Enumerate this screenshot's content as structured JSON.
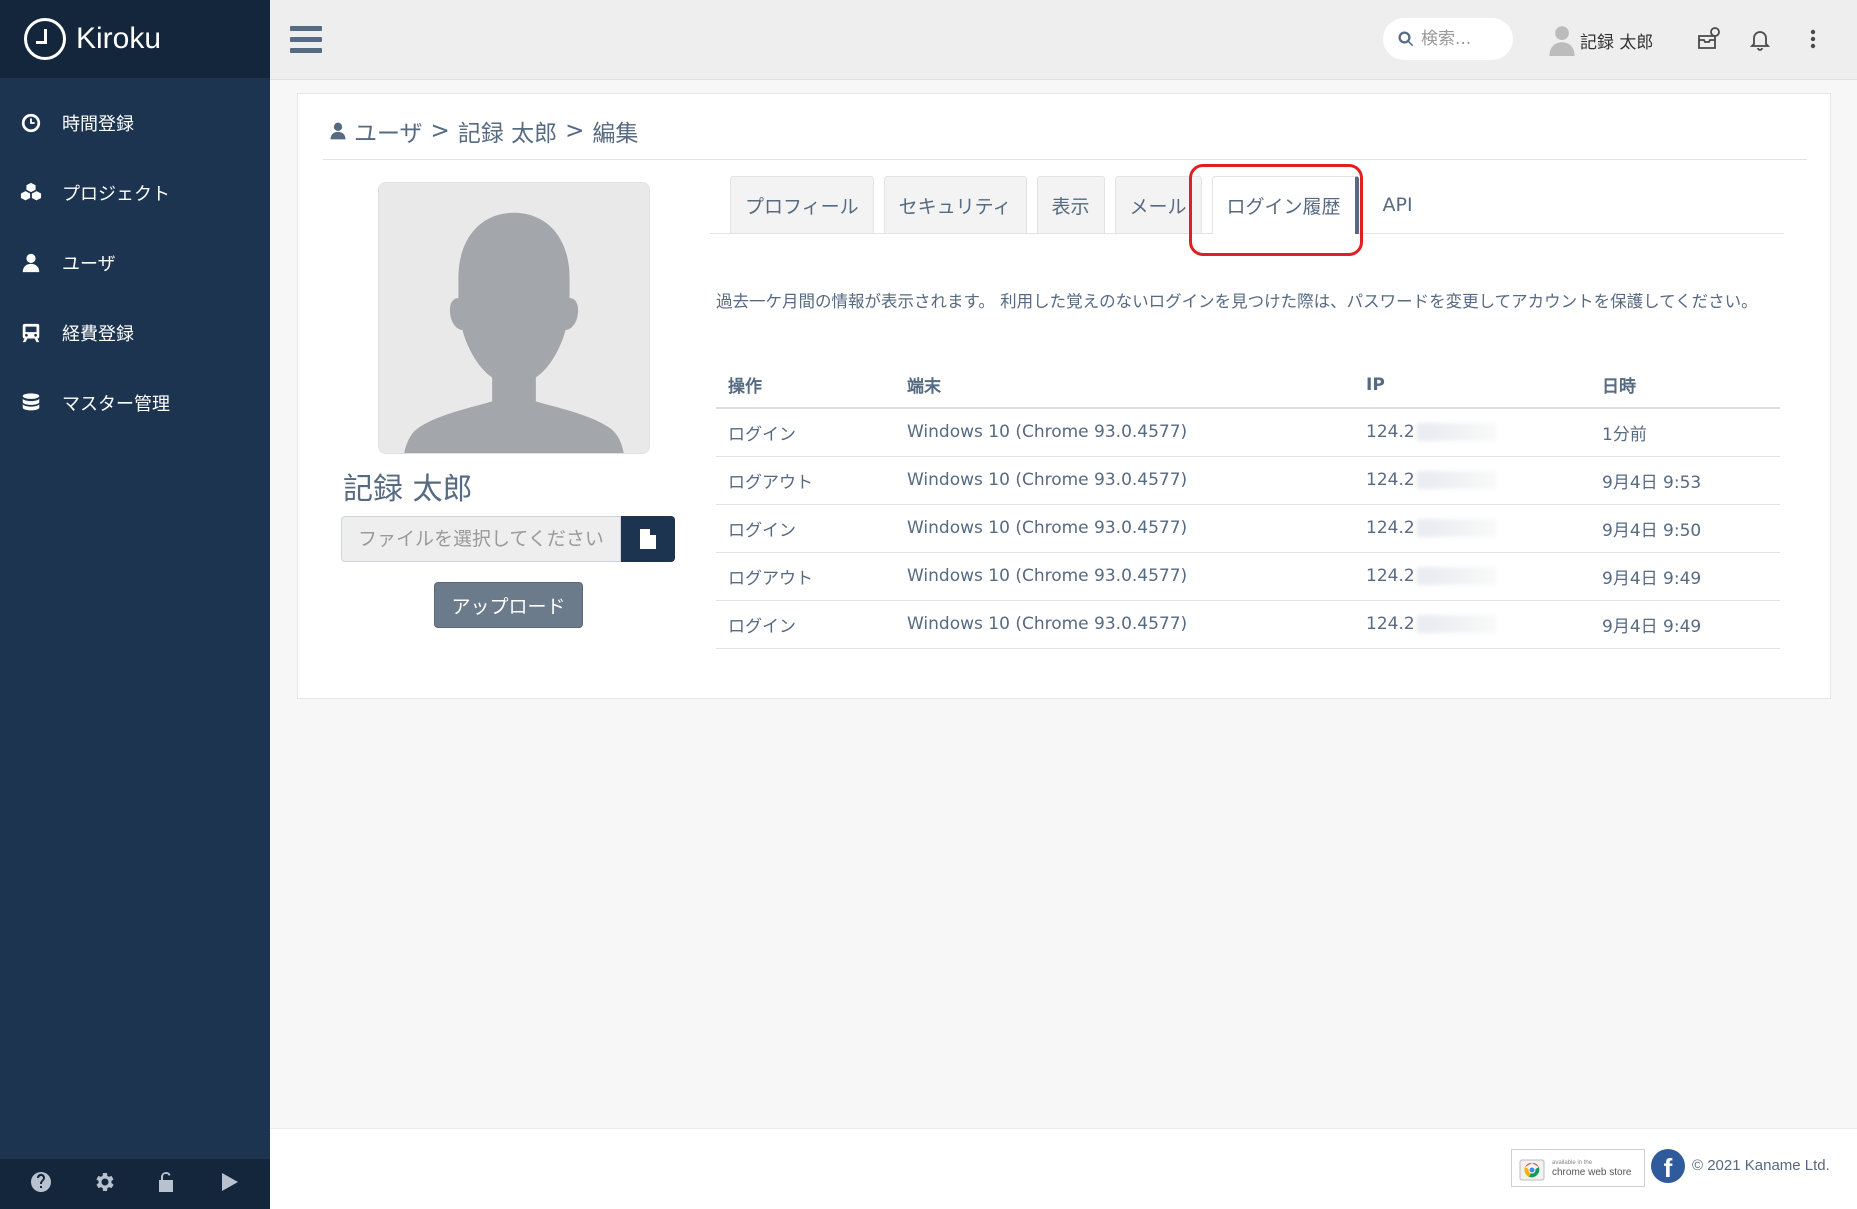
{
  "app": {
    "name": "Kiroku"
  },
  "sidebar": {
    "items": [
      {
        "label": "時間登録",
        "icon": "clock-icon"
      },
      {
        "label": "プロジェクト",
        "icon": "cubes-icon"
      },
      {
        "label": "ユーザ",
        "icon": "user-icon"
      },
      {
        "label": "経費登録",
        "icon": "train-icon"
      },
      {
        "label": "マスター管理",
        "icon": "database-icon"
      }
    ],
    "footer_icons": [
      "help-icon",
      "gear-icon",
      "unlock-icon",
      "play-icon"
    ]
  },
  "topbar": {
    "search_placeholder": "検索...",
    "user_name": "記録 太郎",
    "icons": [
      "menu-icon",
      "search-icon",
      "user-avatar-icon",
      "inbox-icon",
      "bell-icon",
      "more-vertical-icon"
    ]
  },
  "breadcrumb": {
    "items": [
      "ユーザ",
      "記録 太郎",
      "編集"
    ],
    "separator": ">"
  },
  "profile": {
    "name": "記録 太郎",
    "file_placeholder": "ファイルを選択してください",
    "upload_label": "アップロード"
  },
  "tabs": [
    {
      "label": "プロフィール",
      "active": false
    },
    {
      "label": "セキュリティ",
      "active": false
    },
    {
      "label": "表示",
      "active": false
    },
    {
      "label": "メール",
      "active": false
    },
    {
      "label": "ログイン履歴",
      "active": true
    },
    {
      "label": "API",
      "active": false
    }
  ],
  "login_history": {
    "notice": "過去一ケ月間の情報が表示されます。 利用した覚えのないログインを見つけた際は、パスワードを変更してアカウントを保護してください。",
    "columns": [
      "操作",
      "端末",
      "IP",
      "日時"
    ],
    "rows": [
      {
        "action": "ログイン",
        "device": "Windows 10 (Chrome 93.0.4577)",
        "ip": "124.2",
        "time": "1分前"
      },
      {
        "action": "ログアウト",
        "device": "Windows 10 (Chrome 93.0.4577)",
        "ip": "124.2",
        "time": "9月4日 9:53"
      },
      {
        "action": "ログイン",
        "device": "Windows 10 (Chrome 93.0.4577)",
        "ip": "124.2",
        "time": "9月4日 9:50"
      },
      {
        "action": "ログアウト",
        "device": "Windows 10 (Chrome 93.0.4577)",
        "ip": "124.2",
        "time": "9月4日 9:49"
      },
      {
        "action": "ログイン",
        "device": "Windows 10 (Chrome 93.0.4577)",
        "ip": "124.2",
        "time": "9月4日 9:49"
      }
    ]
  },
  "footer": {
    "store_small": "available in the",
    "store_big": "chrome web store",
    "copyright": "© 2021 Kaname Ltd."
  },
  "colors": {
    "sidebar": "#1c3450",
    "accent_text": "#566a82",
    "highlight": "#e02020"
  }
}
